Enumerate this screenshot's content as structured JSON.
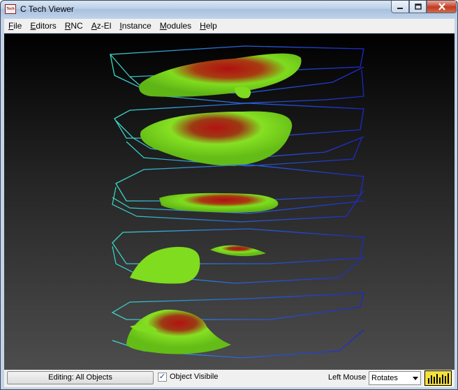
{
  "window": {
    "title": "C Tech Viewer",
    "icon_text": "Tech",
    "controls": [
      "minimize-icon",
      "maximize-icon",
      "close-icon"
    ]
  },
  "menubar": {
    "items": [
      {
        "label": "File"
      },
      {
        "label": "Editors"
      },
      {
        "label": "RNC"
      },
      {
        "label": "Az-El"
      },
      {
        "label": "Instance"
      },
      {
        "label": "Modules"
      },
      {
        "label": "Help"
      }
    ]
  },
  "statusbar": {
    "editing_label": "Editing: All Objects",
    "object_visible_label": "Object Visibile",
    "object_visible_checked": true,
    "left_mouse_label": "Left Mouse",
    "left_mouse_value": "Rotates"
  },
  "colors": {
    "viewport_top": "#000000",
    "viewport_bottom": "#4d4d4d",
    "plume_high": "#b01010",
    "plume_low": "#7fdc1e",
    "layer_outline_deep": "#1e28c8",
    "layer_outline_edge": "#3cdcc8",
    "perf_meter": "#f5e03a"
  }
}
